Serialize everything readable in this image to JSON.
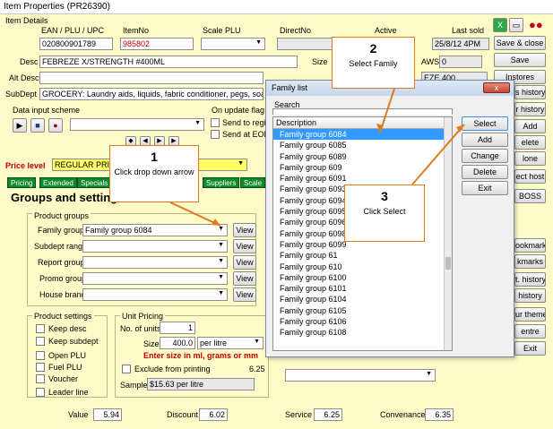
{
  "window": {
    "title": "Item Properties  (PR26390)"
  },
  "item_details": {
    "group_label": "Item Details",
    "ean_label": "EAN / PLU / UPC",
    "ean_value": "020800901789",
    "itemno_label": "ItemNo",
    "itemno_value": "985802",
    "scale_plu_label": "Scale PLU",
    "direct_no_label": "DirectNo",
    "active_label": "Active",
    "last_sold_label": "Last sold",
    "last_sold_value": "25/8/12 4PM",
    "desc_label": "Desc",
    "desc_value": "FEBREZE X/STRENGTH      #400ML",
    "size_label": "Size",
    "aws_label": "AWS",
    "aws_value": "0",
    "alt_desc_label": "Alt Desc",
    "eze_value": "EZE  400",
    "subdept_label": "SubDept",
    "subdept_value": "GROCERY: Laundry aids, liquids, fabric conditioner, pegs, soap, starch"
  },
  "data_input": {
    "label": "Data input scheme",
    "on_update_label": "On update flag p",
    "send_register": "Send to regist",
    "send_eod": "Send at EOD"
  },
  "price_level": {
    "label": "Price level",
    "value": "REGULAR PRICI"
  },
  "tabs": [
    "Pricing",
    "Extended",
    "Specials",
    "",
    "",
    "",
    "Suppliers",
    "Scale"
  ],
  "groups": {
    "heading": "Groups and setting",
    "product_groups_label": "Product groups",
    "family_group_label": "Family group",
    "family_group_value": "Family group 6084",
    "subdept_range_label": "Subdept range",
    "report_group_label": "Report group",
    "promo_group_label": "Promo group",
    "house_brand_label": "House brand",
    "view_label": "View"
  },
  "product_settings": {
    "label": "Product settings",
    "items": [
      "Keep desc",
      "Keep subdept",
      "Open PLU",
      "Fuel PLU",
      "Voucher",
      "Leader line"
    ]
  },
  "unit_pricing": {
    "label": "Unit Pricing",
    "no_units_label": "No. of units",
    "no_units_value": "1",
    "size_label": "Size",
    "size_value": "400.0",
    "per_value": "per litre",
    "enter_size_note": "Enter size in ml, grams or mm",
    "exclude_label": "Exclude from printing",
    "exclude_value": "6.25",
    "sample_label": "Sample",
    "sample_value": "$15.63 per litre"
  },
  "right_buttons": [
    "Save & close",
    "Save",
    "Instores",
    "s history",
    "r history",
    "Add",
    "elete",
    "lone",
    "ect host",
    "BOSS",
    "ookmark",
    "kmarks",
    "t. history",
    "history",
    "ur theme",
    "entre",
    "Exit"
  ],
  "bottom": {
    "value_label": "Value",
    "value": "5.94",
    "discount_label": "Discount",
    "discount": "6.02",
    "service_label": "Service",
    "service": "6.25",
    "convenance_label": "Convenance",
    "convenance": "6.35"
  },
  "family_dialog": {
    "title": "Family list",
    "close_label": "x",
    "search_label": "Search",
    "column_header": "Description",
    "selected_index": 0,
    "items": [
      "Family group 6084",
      "Family group 6085",
      "Family group 6089",
      "Family group 609",
      "Family group 6091",
      "Family group 6093",
      "Family group 6094",
      "Family group 6095",
      "Family group 6096",
      "Family group 6098",
      "Family group 6099",
      "Family group 61",
      "Family group 610",
      "Family group 6100",
      "Family group 6101",
      "Family group 6104",
      "Family group 6105",
      "Family group 6106",
      "Family group 6108"
    ],
    "buttons": [
      "Select",
      "Add",
      "Change",
      "Delete",
      "Exit"
    ]
  },
  "callouts": [
    {
      "num": "1",
      "text": "Click drop down arrow"
    },
    {
      "num": "2",
      "text": "Select Family"
    },
    {
      "num": "3",
      "text": "Click Select"
    }
  ],
  "colors": {
    "background": "#fffbc8",
    "tab_green": "#0e8a2a",
    "selection_blue": "#3399ff",
    "callout_orange": "#e07a1a",
    "warning_red": "#c00000"
  }
}
